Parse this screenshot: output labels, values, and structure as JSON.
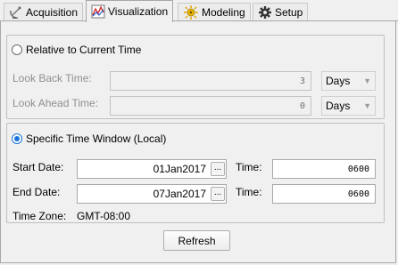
{
  "tabs": [
    {
      "label": "Acquisition",
      "icon": "satellite-dish-icon"
    },
    {
      "label": "Visualization",
      "icon": "chart-icon"
    },
    {
      "label": "Modeling",
      "icon": "sun-gear-icon"
    },
    {
      "label": "Setup",
      "icon": "gear-icon"
    }
  ],
  "active_tab": "Visualization",
  "relative": {
    "option_label": "Relative to Current Time",
    "selected": false,
    "look_back_label": "Look Back Time:",
    "look_back_value": "3",
    "look_back_unit": "Days",
    "look_ahead_label": "Look Ahead Time:",
    "look_ahead_value": "0",
    "look_ahead_unit": "Days"
  },
  "specific": {
    "option_label": "Specific Time Window (Local)",
    "selected": true,
    "start_date_label": "Start Date:",
    "start_date_value": "01Jan2017",
    "start_time_label": "Time:",
    "start_time_value": "0600",
    "end_date_label": "End Date:",
    "end_date_value": "07Jan2017",
    "end_time_label": "Time:",
    "end_time_value": "0600",
    "timezone_label": "Time Zone:",
    "timezone_value": "GMT-08:00",
    "picker_label": "..."
  },
  "refresh_label": "Refresh",
  "colors": {
    "accent": "#1a73d9",
    "disabled_text": "#8f8f8f"
  }
}
